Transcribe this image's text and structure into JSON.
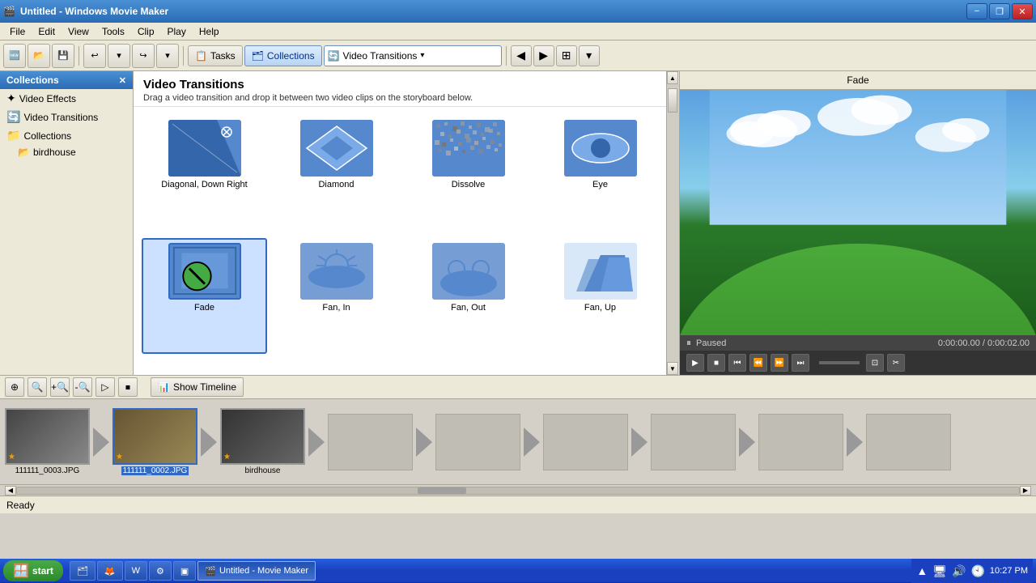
{
  "titlebar": {
    "title": "Untitled - Windows Movie Maker",
    "icon": "🎬",
    "min_btn": "−",
    "max_btn": "❐",
    "close_btn": "✕"
  },
  "menu": {
    "items": [
      "File",
      "Edit",
      "View",
      "Tools",
      "Clip",
      "Play",
      "Help"
    ]
  },
  "toolbar": {
    "tasks_label": "Tasks",
    "collections_label": "Collections",
    "dropdown_label": "Video Transitions",
    "btn_back": "◀",
    "btn_forward": "▶",
    "btn_grid": "⊞"
  },
  "left_panel": {
    "title": "Collections",
    "close": "✕",
    "items": [
      {
        "label": "Video Effects",
        "icon": "✦",
        "indent": 0
      },
      {
        "label": "Video Transitions",
        "icon": "🔄",
        "indent": 0
      },
      {
        "label": "Collections",
        "icon": "📁",
        "indent": 0
      },
      {
        "label": "birdhouse",
        "icon": "📂",
        "indent": 1
      }
    ]
  },
  "content": {
    "title": "Video Transitions",
    "description": "Drag a video transition and drop it between two video clips on the storyboard below.",
    "transitions": [
      {
        "id": "diagonal-down-right",
        "label": "Diagonal, Down Right",
        "type": "diagonal"
      },
      {
        "id": "diamond",
        "label": "Diamond",
        "type": "diamond"
      },
      {
        "id": "dissolve",
        "label": "Dissolve",
        "type": "dissolve"
      },
      {
        "id": "eye",
        "label": "Eye",
        "type": "eye"
      },
      {
        "id": "fade",
        "label": "Fade",
        "type": "fade",
        "selected": true
      },
      {
        "id": "fan-in",
        "label": "Fan, In",
        "type": "fan-in"
      },
      {
        "id": "fan-out",
        "label": "Fan, Out",
        "type": "fan-out"
      },
      {
        "id": "fan-up",
        "label": "Fan, Up",
        "type": "fan-up"
      }
    ]
  },
  "preview": {
    "title": "Fade",
    "status": "Paused",
    "time": "0:00:00.00 / 0:00:02.00",
    "controls": {
      "play": "▶",
      "stop": "■",
      "rewind": "⏮",
      "prev_frame": "⏪",
      "next_frame": "⏩",
      "end": "⏭"
    }
  },
  "storyboard": {
    "show_timeline_label": "Show Timeline",
    "clips": [
      {
        "label": "111111_0003.JPG",
        "selected": false,
        "has_star": true
      },
      {
        "label": "111111_0002.JPG",
        "selected": true,
        "has_star": true
      },
      {
        "label": "birdhouse",
        "selected": false,
        "has_star": true
      }
    ]
  },
  "status": {
    "text": "Ready"
  },
  "taskbar": {
    "start_label": "start",
    "time": "10:27 PM",
    "apps": [
      {
        "label": "🖥 My Computer",
        "active": false
      },
      {
        "label": "🦊 Firefox",
        "active": false
      },
      {
        "label": "W Word",
        "active": false
      },
      {
        "label": "⚙ Settings",
        "active": false
      },
      {
        "label": "🎬 Untitled - Movie Maker",
        "active": true
      }
    ],
    "tray_icons": [
      "▲",
      "🔊",
      "⏰"
    ]
  }
}
